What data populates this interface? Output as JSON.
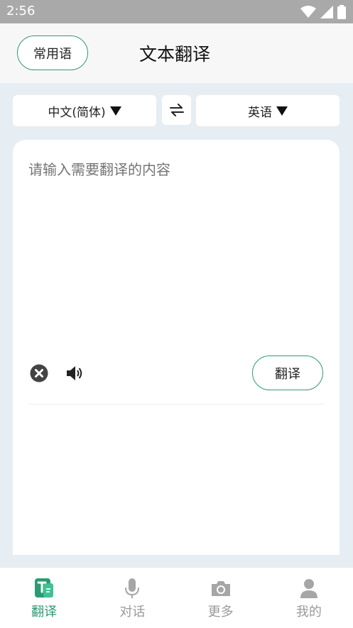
{
  "status_bar": {
    "time": "2:56"
  },
  "header": {
    "phrase_button": "常用语",
    "title": "文本翻译"
  },
  "languages": {
    "source": "中文(简体)",
    "target": "英语"
  },
  "input": {
    "placeholder": "请输入需要翻译的内容",
    "value": ""
  },
  "actions": {
    "translate_button": "翻译"
  },
  "nav": {
    "items": [
      {
        "label": "翻译",
        "icon": "translate-icon",
        "active": true
      },
      {
        "label": "对话",
        "icon": "microphone-icon",
        "active": false
      },
      {
        "label": "更多",
        "icon": "camera-icon",
        "active": false
      },
      {
        "label": "我的",
        "icon": "person-icon",
        "active": false
      }
    ]
  },
  "colors": {
    "accent": "#2a9b72",
    "status_bar": "#a9a9a9",
    "background": "#e6edf3",
    "inactive": "#9a9a9a"
  }
}
